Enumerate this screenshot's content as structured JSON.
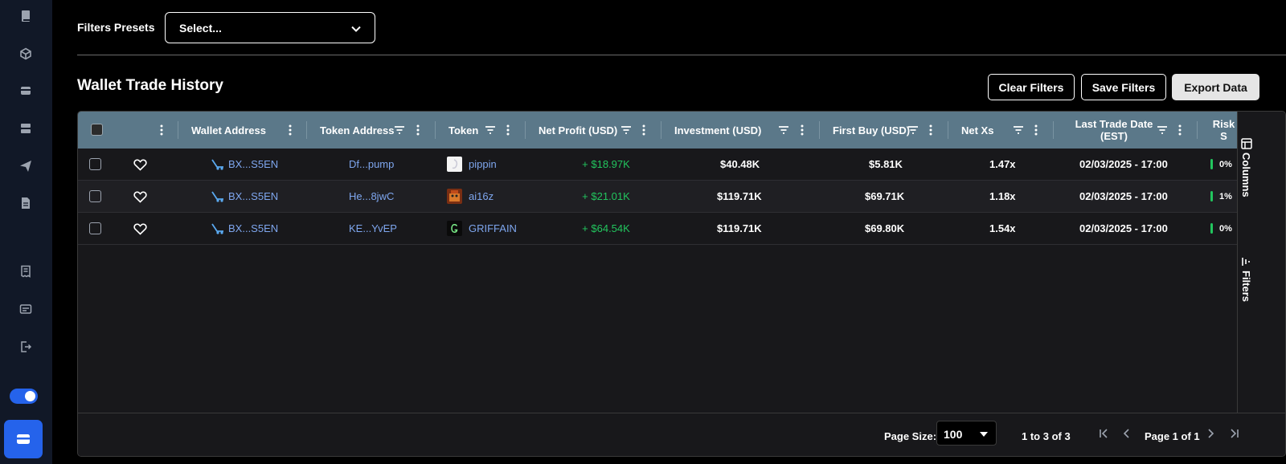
{
  "sidebar": {
    "icons": [
      "book-icon",
      "cube-icon",
      "wallet-icon",
      "server-icon",
      "send-icon",
      "document-icon",
      "receipt-icon",
      "card-icon",
      "logout-icon"
    ],
    "toggle_on": true,
    "active_icon": "wallet-icon"
  },
  "filters": {
    "label": "Filters Presets",
    "select_value": "Select..."
  },
  "section": {
    "title": "Wallet Trade History",
    "clear_filters": "Clear Filters",
    "save_filters": "Save Filters",
    "export_data": "Export Data"
  },
  "table": {
    "columns": [
      "Wallet Address",
      "Token Address",
      "Token",
      "Net Profit (USD)",
      "Investment (USD)",
      "First Buy (USD)",
      "Net Xs",
      "Last Trade Date (EST)",
      "Risk S"
    ],
    "last_trade_line1": "Last Trade Date",
    "last_trade_line2": "(EST)",
    "rows": [
      {
        "wallet": "BX...S5EN",
        "token_address": "Df...pump",
        "token": "pippin",
        "net_profit": "+ $18.97K",
        "investment": "$40.48K",
        "first_buy": "$5.81K",
        "net_xs": "1.47x",
        "last_trade": "02/03/2025 - 17:00",
        "risk": "0%"
      },
      {
        "wallet": "BX...S5EN",
        "token_address": "He...8jwC",
        "token": "ai16z",
        "net_profit": "+ $21.01K",
        "investment": "$119.71K",
        "first_buy": "$69.71K",
        "net_xs": "1.18x",
        "last_trade": "02/03/2025 - 17:00",
        "risk": "1%"
      },
      {
        "wallet": "BX...S5EN",
        "token_address": "KE...YvEP",
        "token": "GRIFFAIN",
        "net_profit": "+ $64.54K",
        "investment": "$119.71K",
        "first_buy": "$69.80K",
        "net_xs": "1.54x",
        "last_trade": "02/03/2025 - 17:00",
        "risk": "0%"
      }
    ]
  },
  "side_tabs": {
    "columns": "Columns",
    "filters": "Filters"
  },
  "footer": {
    "page_size_label": "Page Size:",
    "page_size_value": "100",
    "range": "1 to 3 of 3",
    "page_info": "Page 1 of 1"
  },
  "colors": {
    "header_bg": "#5b7889",
    "accent": "#2563eb",
    "profit": "#22c55e",
    "link": "#7ea6ee"
  }
}
